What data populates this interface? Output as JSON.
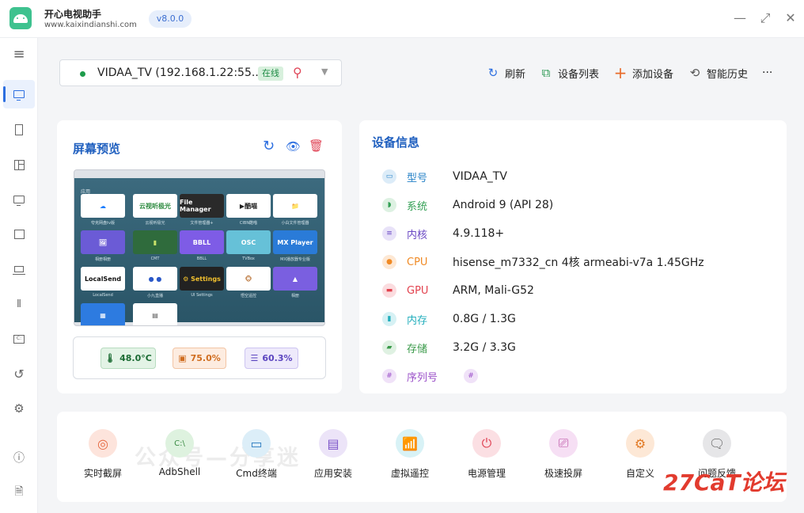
{
  "app": {
    "name": "开心电视助手",
    "url": "www.kaixindianshi.com",
    "version": "v8.0.0"
  },
  "window_controls": {
    "minimize": "—",
    "maximize": "⤢",
    "close": "✕"
  },
  "device": {
    "name": "VIDAA_TV (192.168.1.22:55...",
    "status": "在线",
    "status_color": "#1e9b4b"
  },
  "top_actions": [
    {
      "label": "刷新",
      "icon": "refresh-icon"
    },
    {
      "label": "设备列表",
      "icon": "device-list-icon"
    },
    {
      "label": "添加设备",
      "icon": "plus-icon"
    },
    {
      "label": "智能历史",
      "icon": "history-icon"
    }
  ],
  "more": "···",
  "preview": {
    "title": "屏幕预览",
    "screen_header": "应用",
    "apps": [
      {
        "name": "夸克网盘tv版",
        "label": "☁",
        "bg": "#ffffff",
        "fg": "#1a7dff"
      },
      {
        "name": "云视听极光",
        "label": "云视听极光",
        "bg": "#ffffff",
        "fg": "#2b8a3e"
      },
      {
        "name": "文件管理器+",
        "label": "File Manager",
        "bg": "#2a2a2a",
        "fg": "#ffffff"
      },
      {
        "name": "CIBN酷喵",
        "label": "▶酷喵",
        "bg": "#ffffff",
        "fg": "#222222"
      },
      {
        "name": "小白文件管理器",
        "label": "📁",
        "bg": "#ffffff",
        "fg": "#1a9fe0"
      },
      {
        "name": "相册相册",
        "label": "🖼",
        "bg": "#6b5bd6",
        "fg": "#ffffff"
      },
      {
        "name": "CMT",
        "label": "▮",
        "bg": "#2f6b3c",
        "fg": "#c8e26a"
      },
      {
        "name": "BBLL",
        "label": "BBLL",
        "bg": "#7e5ce6",
        "fg": "#ffffff"
      },
      {
        "name": "TVBox",
        "label": "OSC",
        "bg": "#66c1d8",
        "fg": "#ffffff"
      },
      {
        "name": "MX播放器专业版",
        "label": "MX Player",
        "bg": "#2a7bd8",
        "fg": "#ffffff"
      },
      {
        "name": "LocalSend",
        "label": "LocalSend",
        "bg": "#ffffff",
        "fg": "#111111"
      },
      {
        "name": "小九直播",
        "label": "● ●",
        "bg": "#ffffff",
        "fg": "#2a58c8"
      },
      {
        "name": "UI Settings",
        "label": "⚙ Settings",
        "bg": "#222222",
        "fg": "#f2c12e"
      },
      {
        "name": "悟空遥控",
        "label": "🐵",
        "bg": "#ffffff",
        "fg": "#b56a2a"
      },
      {
        "name": "相册",
        "label": "▲",
        "bg": "#7a5fe0",
        "fg": "#ffffff"
      },
      {
        "name": "",
        "label": "▦",
        "bg": "#2d7be0",
        "fg": "#ffffff"
      },
      {
        "name": "",
        "label": "▤",
        "bg": "#ffffff",
        "fg": "#555555"
      }
    ],
    "stats": [
      {
        "label": "48.0°C",
        "icon": "thermometer-icon",
        "glyph": "🌡",
        "bg": "#e3f3e6",
        "border": "#b8dcc0",
        "color": "#1b6b33"
      },
      {
        "label": "75.0%",
        "icon": "cpu-icon",
        "glyph": "▣",
        "bg": "#fdece0",
        "border": "#f2c5a5",
        "color": "#d06d1f"
      },
      {
        "label": "60.3%",
        "icon": "memory-icon",
        "glyph": "☰",
        "bg": "#eeeafb",
        "border": "#cdc4f1",
        "color": "#5b45c0"
      }
    ]
  },
  "info": {
    "title": "设备信息",
    "rows": [
      {
        "key": "型号",
        "value": "VIDAA_TV",
        "icon": "model-icon",
        "glyph": "▭",
        "color": "#2a84c8",
        "bg": "#dcecf8"
      },
      {
        "key": "系统",
        "value": "Android 9 (API 28)",
        "icon": "android-icon",
        "glyph": "◗",
        "color": "#34a055",
        "bg": "#ddf1e2"
      },
      {
        "key": "内核",
        "value": "4.9.118+",
        "icon": "kernel-icon",
        "glyph": "≡",
        "color": "#6a48c4",
        "bg": "#e8e2f8"
      },
      {
        "key": "CPU",
        "value": "hisense_m7332_cn 4核 armeabi-v7a 1.45GHz",
        "icon": "cpu-icon",
        "glyph": "●",
        "color": "#f08a25",
        "bg": "#fde8d4"
      },
      {
        "key": "GPU",
        "value": "ARM, Mali-G52",
        "icon": "gpu-icon",
        "glyph": "▬",
        "color": "#e2424e",
        "bg": "#fbdcdf"
      },
      {
        "key": "内存",
        "value": "0.8G / 1.3G",
        "icon": "memory-icon",
        "glyph": "▮",
        "color": "#23aebc",
        "bg": "#d6f1f4"
      },
      {
        "key": "存储",
        "value": "3.2G / 3.3G",
        "icon": "storage-icon",
        "glyph": "▰",
        "color": "#3a9a4a",
        "bg": "#dff1e2"
      },
      {
        "key": "序列号",
        "value": "",
        "icon": "serial-icon",
        "glyph": "#",
        "color": "#9a4fc8",
        "bg": "#f0e2f8"
      }
    ]
  },
  "tools": [
    {
      "label": "实时截屏",
      "icon": "camera-icon",
      "glyph": "◎",
      "bg": "#fde4dc",
      "fg": "#e5673f"
    },
    {
      "label": "AdbShell",
      "icon": "shell-icon",
      "glyph": "C:\\",
      "bg": "#def2df",
      "fg": "#3a8a44"
    },
    {
      "label": "Cmd终端",
      "icon": "terminal-icon",
      "glyph": "▭",
      "bg": "#dceef8",
      "fg": "#2a7bc0"
    },
    {
      "label": "应用安装",
      "icon": "install-icon",
      "glyph": "▤",
      "bg": "#ece4f8",
      "fg": "#7a52c8"
    },
    {
      "label": "虚拟遥控",
      "icon": "remote-icon",
      "glyph": "📶",
      "bg": "#d8f2f6",
      "fg": "#1aa6c0"
    },
    {
      "label": "电源管理",
      "icon": "power-icon",
      "glyph": "⏻",
      "bg": "#fbdfe3",
      "fg": "#e04456"
    },
    {
      "label": "极速投屏",
      "icon": "cast-icon",
      "glyph": "⎚",
      "bg": "#f6dff4",
      "fg": "#b8469f"
    },
    {
      "label": "自定义",
      "icon": "custom-gear-icon",
      "glyph": "⚙",
      "bg": "#fde8d6",
      "fg": "#e27a25"
    },
    {
      "label": "问题反馈",
      "icon": "feedback-icon",
      "glyph": "🗨",
      "bg": "#e6e6e8",
      "fg": "#555555"
    }
  ],
  "watermarks": {
    "center": "公众号—分享迷",
    "corner": "27CaT论坛"
  }
}
